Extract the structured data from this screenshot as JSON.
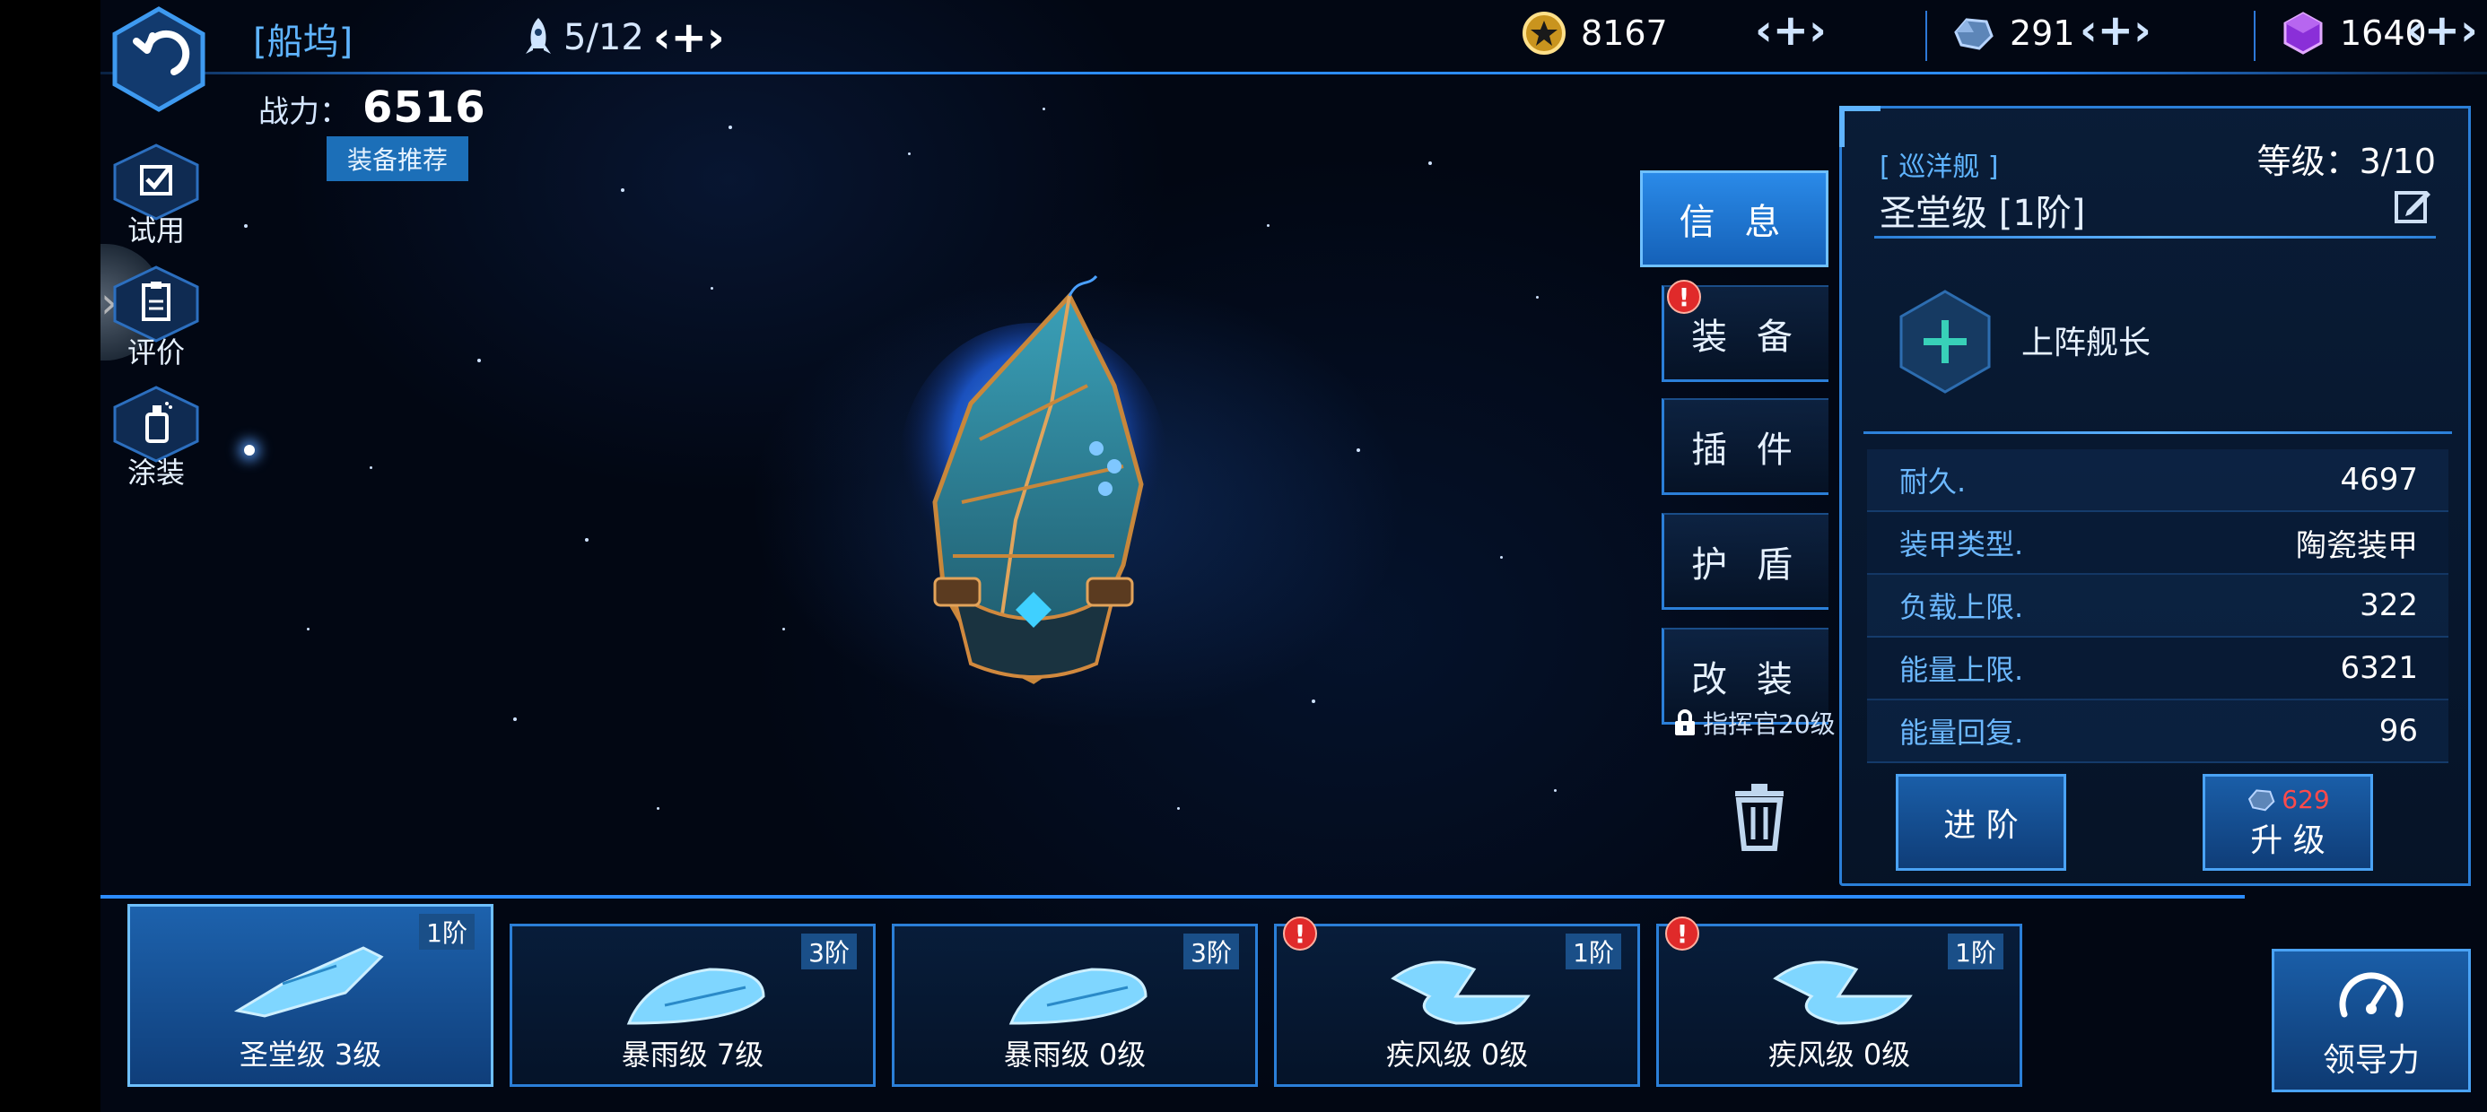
{
  "header": {
    "title": "[船坞]",
    "fleet_count": "5/12",
    "resources": [
      {
        "name": "gold-coin-icon",
        "value": "8167"
      },
      {
        "name": "crystal-ore-icon",
        "value": "291"
      },
      {
        "name": "purple-gem-icon",
        "value": "1640"
      }
    ]
  },
  "power": {
    "label": "战力：",
    "value": "6516"
  },
  "recommend_label": "装备推荐",
  "side_menu": [
    {
      "label": "试用",
      "icon": "checkbox-icon"
    },
    {
      "label": "评价",
      "icon": "clipboard-icon"
    },
    {
      "label": "涂装",
      "icon": "spray-can-icon"
    }
  ],
  "tabs": [
    {
      "label": "信 息",
      "active": true,
      "alert": false
    },
    {
      "label": "装 备",
      "active": false,
      "alert": true
    },
    {
      "label": "插 件",
      "active": false,
      "alert": false
    },
    {
      "label": "护 盾",
      "active": false,
      "alert": false
    },
    {
      "label": "改 装",
      "active": false,
      "alert": false
    }
  ],
  "tab_lock_note": "指挥官20级",
  "panel": {
    "ship_class": "[ 巡洋舰 ]",
    "ship_name": "圣堂级 [1阶]",
    "level": "等级：3/10",
    "captain_label": "上阵舰长",
    "stats": [
      {
        "label": "耐久.",
        "value": "4697"
      },
      {
        "label": "装甲类型.",
        "value": "陶瓷装甲"
      },
      {
        "label": "负载上限.",
        "value": "322"
      },
      {
        "label": "能量上限.",
        "value": "6321"
      },
      {
        "label": "能量回复.",
        "value": "96"
      }
    ],
    "advance_label": "进 阶",
    "upgrade_label": "升 级",
    "upgrade_cost": "629"
  },
  "ships": [
    {
      "name": "圣堂级 3级",
      "tier": "1阶",
      "active": true,
      "alert": false
    },
    {
      "name": "暴雨级 7级",
      "tier": "3阶",
      "active": false,
      "alert": false
    },
    {
      "name": "暴雨级 0级",
      "tier": "3阶",
      "active": false,
      "alert": false
    },
    {
      "name": "疾风级 0级",
      "tier": "1阶",
      "active": false,
      "alert": true
    },
    {
      "name": "疾风级 0级",
      "tier": "1阶",
      "active": false,
      "alert": true
    }
  ],
  "leader_label": "领导力",
  "colors": {
    "accent": "#2b7fd8",
    "highlight": "#5fb4ff",
    "alert": "#e02a2a",
    "cost_red": "#ff4a4a"
  }
}
